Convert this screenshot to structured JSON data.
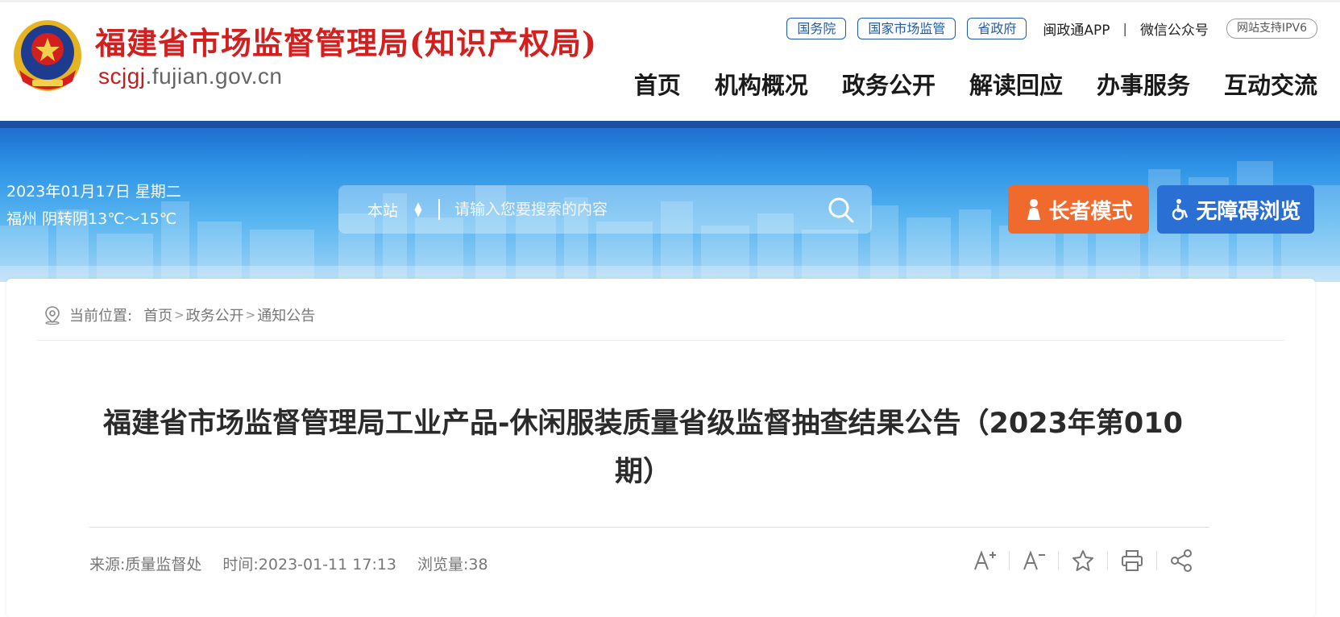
{
  "header": {
    "site_name": "福建省市场监督管理局(知识产权局)",
    "domain_highlight": "scjgj",
    "domain_rest": ".fujian.gov.cn",
    "top_links": [
      "国务院",
      "国家市场监管",
      "省政府"
    ],
    "app_link": "闽政通APP",
    "separator": "|",
    "wechat_link": "微信公众号",
    "ipv6_badge": "网站支持IPV6",
    "nav": [
      "首页",
      "机构概况",
      "政务公开",
      "解读回应",
      "办事服务",
      "互动交流"
    ]
  },
  "banner": {
    "date_line": "2023年01月17日 星期二",
    "weather_line": "福州 阴转阴13℃～15℃",
    "search_scope": "本站",
    "search_placeholder": "请输入您要搜索的内容",
    "elder_mode_label": "长者模式",
    "accessibility_label": "无障碍浏览"
  },
  "breadcrumb": {
    "label": "当前位置:",
    "items": [
      "首页",
      "政务公开",
      "通知公告"
    ],
    "separator": ">"
  },
  "article": {
    "title": "福建省市场监督管理局工业产品-休闲服装质量省级监督抽查结果公告（2023年第010期）",
    "source": "来源:质量监督处",
    "time": "时间:2023-01-11 17:13",
    "views": "浏览量:38"
  },
  "colors": {
    "brand_red": "#d41f1f",
    "link_blue": "#1e5bb0",
    "elder_orange": "#f06a2e",
    "access_blue": "#2a6fd4"
  },
  "icons": [
    "emblem-icon",
    "search-icon",
    "elder-icon",
    "wheelchair-icon",
    "location-icon",
    "font-increase-icon",
    "font-decrease-icon",
    "star-icon",
    "print-icon",
    "share-icon"
  ]
}
